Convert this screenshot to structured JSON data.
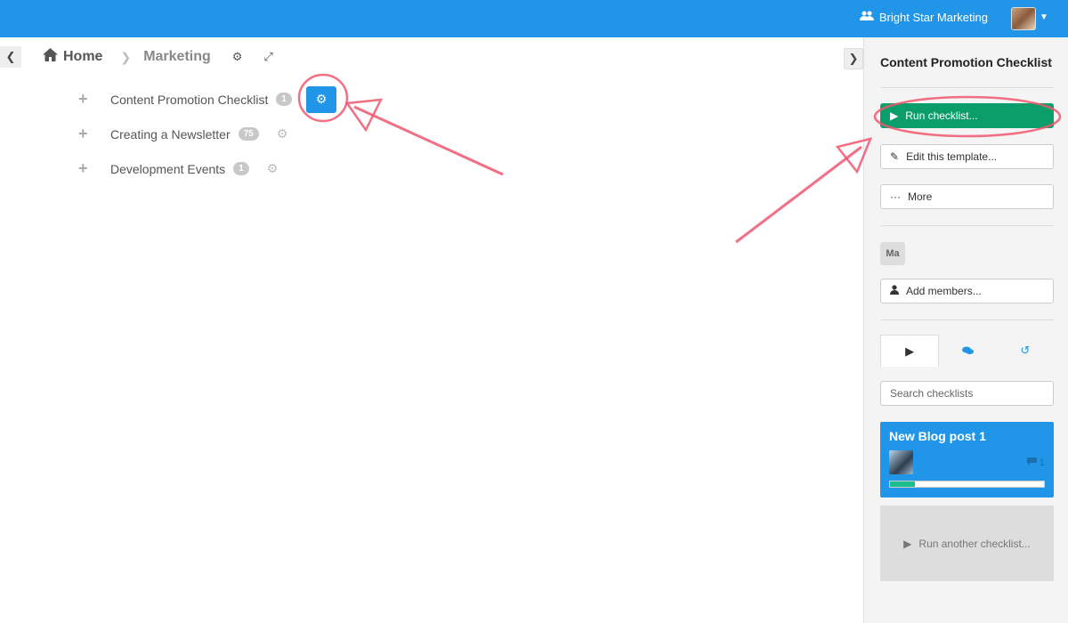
{
  "topbar": {
    "org_name": "Bright Star Marketing",
    "org_icon": "users-icon",
    "accent": "#2196e8"
  },
  "breadcrumb": {
    "home_label": "Home",
    "section_label": "Marketing"
  },
  "checklists": [
    {
      "name": "Content Promotion Checklist",
      "count": "1"
    },
    {
      "name": "Creating a Newsletter",
      "count": "75"
    },
    {
      "name": "Development Events",
      "count": "1"
    }
  ],
  "sidebar": {
    "title": "Content Promotion Checklist",
    "run_label": "Run checklist...",
    "edit_label": "Edit this template...",
    "more_label": "More",
    "member_initials": "Ma",
    "add_members_label": "Add members...",
    "search_placeholder": "Search checklists",
    "card": {
      "title": "New Blog post 1",
      "comment_count": "1",
      "progress_fraction": 0.16
    },
    "run_another_label": "Run another checklist...",
    "run_color": "#0b9e6b"
  }
}
